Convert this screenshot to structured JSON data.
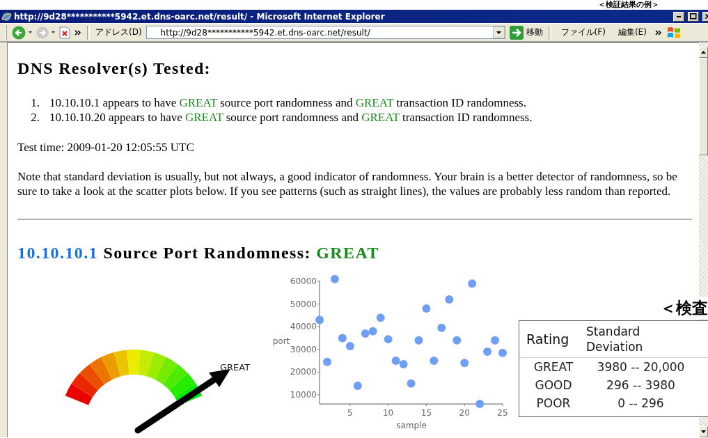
{
  "annotation_top": "＜検証結果の例＞",
  "window": {
    "title": "http://9d28***********5942.et.dns-oarc.net/result/ - Microsoft Internet Explorer"
  },
  "toolbar": {
    "address_label": "アドレス(D)",
    "address": "http://9d28***********5942.et.dns-oarc.net/result/",
    "go_label": "移動",
    "menus": [
      "ファイル(F)",
      "編集(E)"
    ]
  },
  "report": {
    "heading": "DNS Resolver(s) Tested:",
    "results": [
      {
        "number": "1.",
        "segments": [
          {
            "kind": "plain",
            "text": "10.10.10.1 appears to have "
          },
          {
            "kind": "rating",
            "text": "GREAT"
          },
          {
            "kind": "plain",
            "text": " source port randomness and "
          },
          {
            "kind": "rating",
            "text": "GREAT"
          },
          {
            "kind": "plain",
            "text": " transaction ID randomness."
          }
        ]
      },
      {
        "number": "2.",
        "segments": [
          {
            "kind": "plain",
            "text": "10.10.10.20 appears to have "
          },
          {
            "kind": "rating",
            "text": "GREAT"
          },
          {
            "kind": "plain",
            "text": " source port randomness and "
          },
          {
            "kind": "rating",
            "text": "GREAT"
          },
          {
            "kind": "plain",
            "text": " transaction ID randomness."
          }
        ]
      }
    ],
    "test_time": "Test time: 2009-01-20 12:05:55 UTC",
    "note": "Note that standard deviation is usually, but not always, a good indicator of randomness. Your brain is a better detector of randomness, so be sure to take a look at the scatter plots below. If you see patterns (such as straight lines), the values are probably less random than reported.",
    "section_heading": [
      {
        "kind": "ip",
        "text": "10.10.10.1"
      },
      {
        "kind": "plain",
        "text": " Source Port Randomness: "
      },
      {
        "kind": "rating",
        "text": "GREAT"
      }
    ],
    "gauge": {
      "label": "GREAT"
    },
    "chart_data": {
      "type": "scatter",
      "xlabel": "sample",
      "ylabel": "port",
      "xlim": [
        1,
        25
      ],
      "ylim": [
        6000,
        61000
      ],
      "xticks": [
        5,
        10,
        15,
        20,
        25
      ],
      "yticks": [
        10000,
        20000,
        30000,
        40000,
        50000,
        60000
      ],
      "x": [
        1,
        2,
        3,
        4,
        5,
        6,
        7,
        8,
        9,
        10,
        11,
        12,
        13,
        14,
        15,
        16,
        17,
        18,
        19,
        20,
        21,
        22,
        23,
        24,
        25
      ],
      "series": [
        {
          "color": "#6f9ff5",
          "values": [
            43000,
            24500,
            61000,
            35000,
            31500,
            14000,
            37000,
            38000,
            44000,
            34500,
            25000,
            23500,
            15000,
            34000,
            48000,
            25000,
            39500,
            52000,
            34000,
            24000,
            59000,
            6000,
            29000,
            34000,
            28500
          ]
        }
      ]
    }
  },
  "overlay": {
    "annotation": "＜検査",
    "columns": [
      "Rating",
      "Standard Deviation"
    ],
    "rows": [
      [
        "GREAT",
        "3980 -- 20,000"
      ],
      [
        "GOOD",
        "296 -- 3980"
      ],
      [
        "POOR",
        "0 -- 296"
      ]
    ]
  }
}
